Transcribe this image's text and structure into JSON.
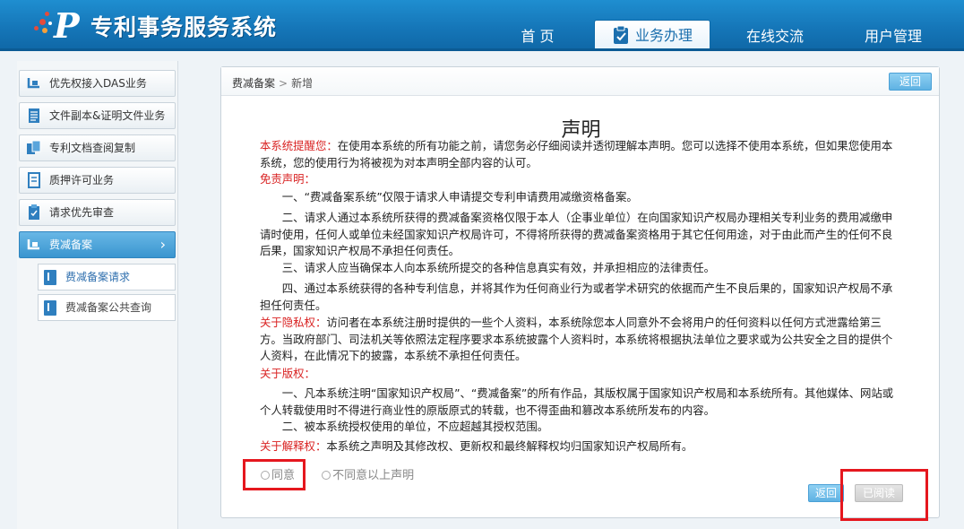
{
  "header": {
    "system_title": "专利事务服务系统",
    "nav": [
      {
        "label": "首 页"
      },
      {
        "label": "业务办理",
        "active": true
      },
      {
        "label": "在线交流"
      },
      {
        "label": "用户管理"
      }
    ]
  },
  "sidebar": {
    "items": [
      {
        "label": "优先权接入DAS业务",
        "icon": "link-icon"
      },
      {
        "label": "文件副本&证明文件业务",
        "icon": "document-icon"
      },
      {
        "label": "专利文档查阅复制",
        "icon": "copy-icon"
      },
      {
        "label": "质押许可业务",
        "icon": "contract-icon"
      },
      {
        "label": "请求优先审查",
        "icon": "clipboard-icon"
      },
      {
        "label": "费减备案",
        "icon": "link-icon",
        "active": true
      }
    ],
    "sub_items": [
      {
        "label": "费减备案请求",
        "icon": "book-icon"
      },
      {
        "label": "费减备案公共查询",
        "icon": "book-icon"
      }
    ]
  },
  "panel": {
    "breadcrumb": {
      "parent": "费减备案",
      "separator": ">",
      "current": "新增"
    },
    "back_top": "返回",
    "title": "声明",
    "intro_red": "本系统提醒您：",
    "intro": "在使用本系统的所有功能之前，请您务必仔细阅读并透彻理解本声明。您可以选择不使用本系统，但如果您使用本系统，您的使用行为将被视为对本声明全部内容的认可。",
    "disclaimer_heading": "免责声明：",
    "disclaimer": [
      "一、“费减备案系统”仅限于请求人申请提交专利申请费用减缴资格备案。",
      "二、请求人通过本系统所获得的费减备案资格仅限于本人（企事业单位）在向国家知识产权局办理相关专利业务的费用减缴申请时使用，任何人或单位未经国家知识产权局许可，不得将所获得的费减备案资格用于其它任何用途，对于由此而产生的任何不良后果，国家知识产权局不承担任何责任。",
      "三、请求人应当确保本人向本系统所提交的各种信息真实有效，并承担相应的法律责任。",
      "四、通过本系统获得的各种专利信息，并将其作为任何商业行为或者学术研究的依据而产生不良后果的，国家知识产权局不承担任何责任。"
    ],
    "privacy_heading": "关于隐私权：",
    "privacy": "访问者在本系统注册时提供的一些个人资料，本系统除您本人同意外不会将用户的任何资料以任何方式泄露给第三方。当政府部门、司法机关等依照法定程序要求本系统披露个人资料时，本系统将根据执法单位之要求或为公共安全之目的提供个人资料，在此情况下的披露，本系统不承担任何责任。",
    "copyright_heading": "关于版权：",
    "copyright": [
      "一、凡本系统注明“国家知识产权局”、“费减备案”的所有作品，其版权属于国家知识产权局和本系统所有。其他媒体、网站或个人转载使用时不得进行商业性的原版原式的转载，也不得歪曲和篡改本系统所发布的内容。",
      "二、被本系统授权使用的单位，不应超越其授权范围。"
    ],
    "interpret_heading": "关于解释权：",
    "interpret": "本系统之声明及其修改权、更新权和最终解释权均归国家知识产权局所有。",
    "agree_label": "同意",
    "disagree_label": "不同意以上声明",
    "back_bottom": "返回",
    "read_button": "已阅读"
  },
  "colors": {
    "header_blue": "#1576b8",
    "highlight_red": "#e5171e",
    "text_red": "#d92323",
    "button_blue": "#5fb2e3"
  }
}
